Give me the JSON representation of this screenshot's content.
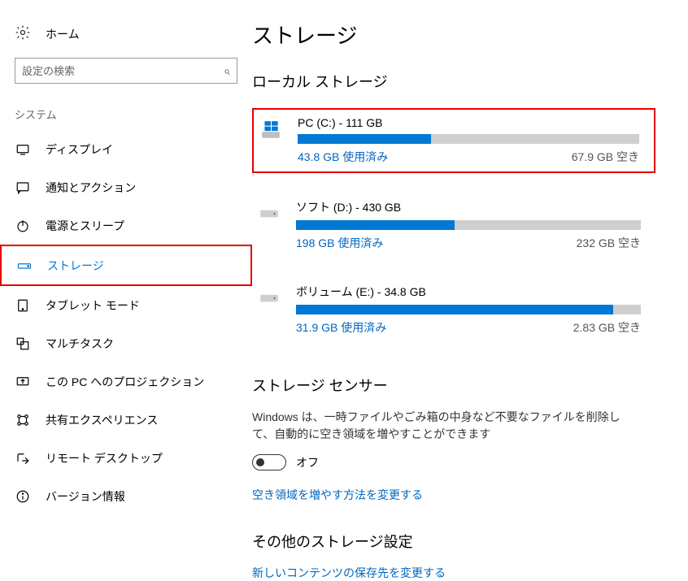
{
  "home_label": "ホーム",
  "search_placeholder": "設定の検索",
  "sidebar_section": "システム",
  "nav": [
    {
      "key": "display",
      "label": "ディスプレイ"
    },
    {
      "key": "notifications",
      "label": "通知とアクション"
    },
    {
      "key": "power",
      "label": "電源とスリープ"
    },
    {
      "key": "storage",
      "label": "ストレージ"
    },
    {
      "key": "tablet",
      "label": "タブレット モード"
    },
    {
      "key": "multitask",
      "label": "マルチタスク"
    },
    {
      "key": "project",
      "label": "この PC へのプロジェクション"
    },
    {
      "key": "shared",
      "label": "共有エクスペリエンス"
    },
    {
      "key": "remote",
      "label": "リモート デスクトップ"
    },
    {
      "key": "about",
      "label": "バージョン情報"
    }
  ],
  "page_title": "ストレージ",
  "local_storage_heading": "ローカル ストレージ",
  "drives": [
    {
      "title": "PC (C:) - 111 GB",
      "used_label": "43.8 GB 使用済み",
      "free_label": "67.9 GB 空き",
      "used_pct": 39
    },
    {
      "title": "ソフト (D:) - 430 GB",
      "used_label": "198 GB 使用済み",
      "free_label": "232 GB 空き",
      "used_pct": 46
    },
    {
      "title": "ボリューム (E:) - 34.8 GB",
      "used_label": "31.9 GB 使用済み",
      "free_label": "2.83 GB 空き",
      "used_pct": 92
    }
  ],
  "storage_sense": {
    "heading": "ストレージ センサー",
    "desc": "Windows は、一時ファイルやごみ箱の中身など不要なファイルを削除して、自動的に空き領域を増やすことができます",
    "toggle_label": "オフ",
    "link": "空き領域を増やす方法を変更する"
  },
  "other": {
    "heading": "その他のストレージ設定",
    "link": "新しいコンテンツの保存先を変更する"
  }
}
